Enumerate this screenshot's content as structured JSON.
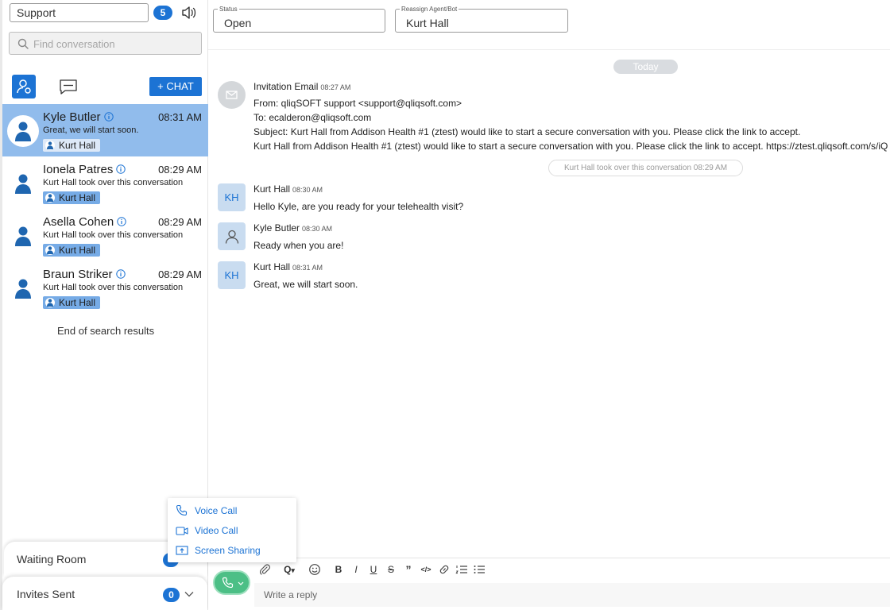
{
  "sidebar": {
    "queue": "Support",
    "queue_count": "5",
    "search_placeholder": "Find conversation",
    "new_chat_label": "+ CHAT",
    "conversations": [
      {
        "name": "Kyle Butler",
        "time": "08:31 AM",
        "preview": "Great, we will start soon.",
        "agent": "Kurt Hall",
        "selected": true
      },
      {
        "name": "Ionela Patres",
        "time": "08:29 AM",
        "preview": "Kurt Hall took over this conversation",
        "agent": "Kurt Hall"
      },
      {
        "name": "Asella Cohen",
        "time": "08:29 AM",
        "preview": "Kurt Hall took over this conversation",
        "agent": "Kurt Hall"
      },
      {
        "name": "Braun Striker",
        "time": "08:29 AM",
        "preview": "Kurt Hall took over this conversation",
        "agent": "Kurt Hall"
      }
    ],
    "end_of_results": "End of search results",
    "waiting_room_label": "Waiting Room",
    "invites_sent_label": "Invites Sent",
    "invites_sent_count": "0"
  },
  "header": {
    "status_label": "Status",
    "status_value": "Open",
    "reassign_label": "Reassign Agent/Bot",
    "reassign_value": "Kurt Hall"
  },
  "thread": {
    "date_divider": "Today",
    "invitation": {
      "sender": "Invitation Email",
      "time": "08:27 AM",
      "from": "From: qliqSOFT support <support@qliqsoft.com>",
      "to": "To: ecalderon@qliqsoft.com",
      "subject": "Subject: Kurt Hall from Addison Health #1 (ztest) would like to start a secure conversation with you. Please click the link to accept.",
      "body": "Kurt Hall from Addison Health #1 (ztest) would like to start a secure conversation with you. Please click the link to accept. https://ztest.qliqsoft.com/s/iQ"
    },
    "system_note": "Kurt Hall took over this conversation 08:29 AM",
    "messages": [
      {
        "initials": "KH",
        "sender": "Kurt Hall",
        "time": "08:30 AM",
        "text": "Hello Kyle, are you ready for your telehealth visit?"
      },
      {
        "initials": "",
        "sender": "Kyle Butler",
        "time": "08:30 AM",
        "text": "Ready when you are!"
      },
      {
        "initials": "KH",
        "sender": "Kurt Hall",
        "time": "08:31 AM",
        "text": "Great, we will start soon."
      }
    ]
  },
  "call_menu": {
    "voice_call": "Voice Call",
    "video_call": "Video Call",
    "screen_sharing": "Screen Sharing"
  },
  "composer": {
    "placeholder": "Write a reply",
    "tools": [
      "attach-icon",
      "qr-icon",
      "emoji-icon",
      "bold-icon",
      "italic-icon",
      "underline-icon",
      "strikethrough-icon",
      "quote-icon",
      "code-icon",
      "link-icon",
      "numbered-list-icon",
      "bullet-list-icon"
    ]
  },
  "colors": {
    "accent": "#1c73d4",
    "selected_row": "#91bcec",
    "call_green": "#4cbf86"
  }
}
